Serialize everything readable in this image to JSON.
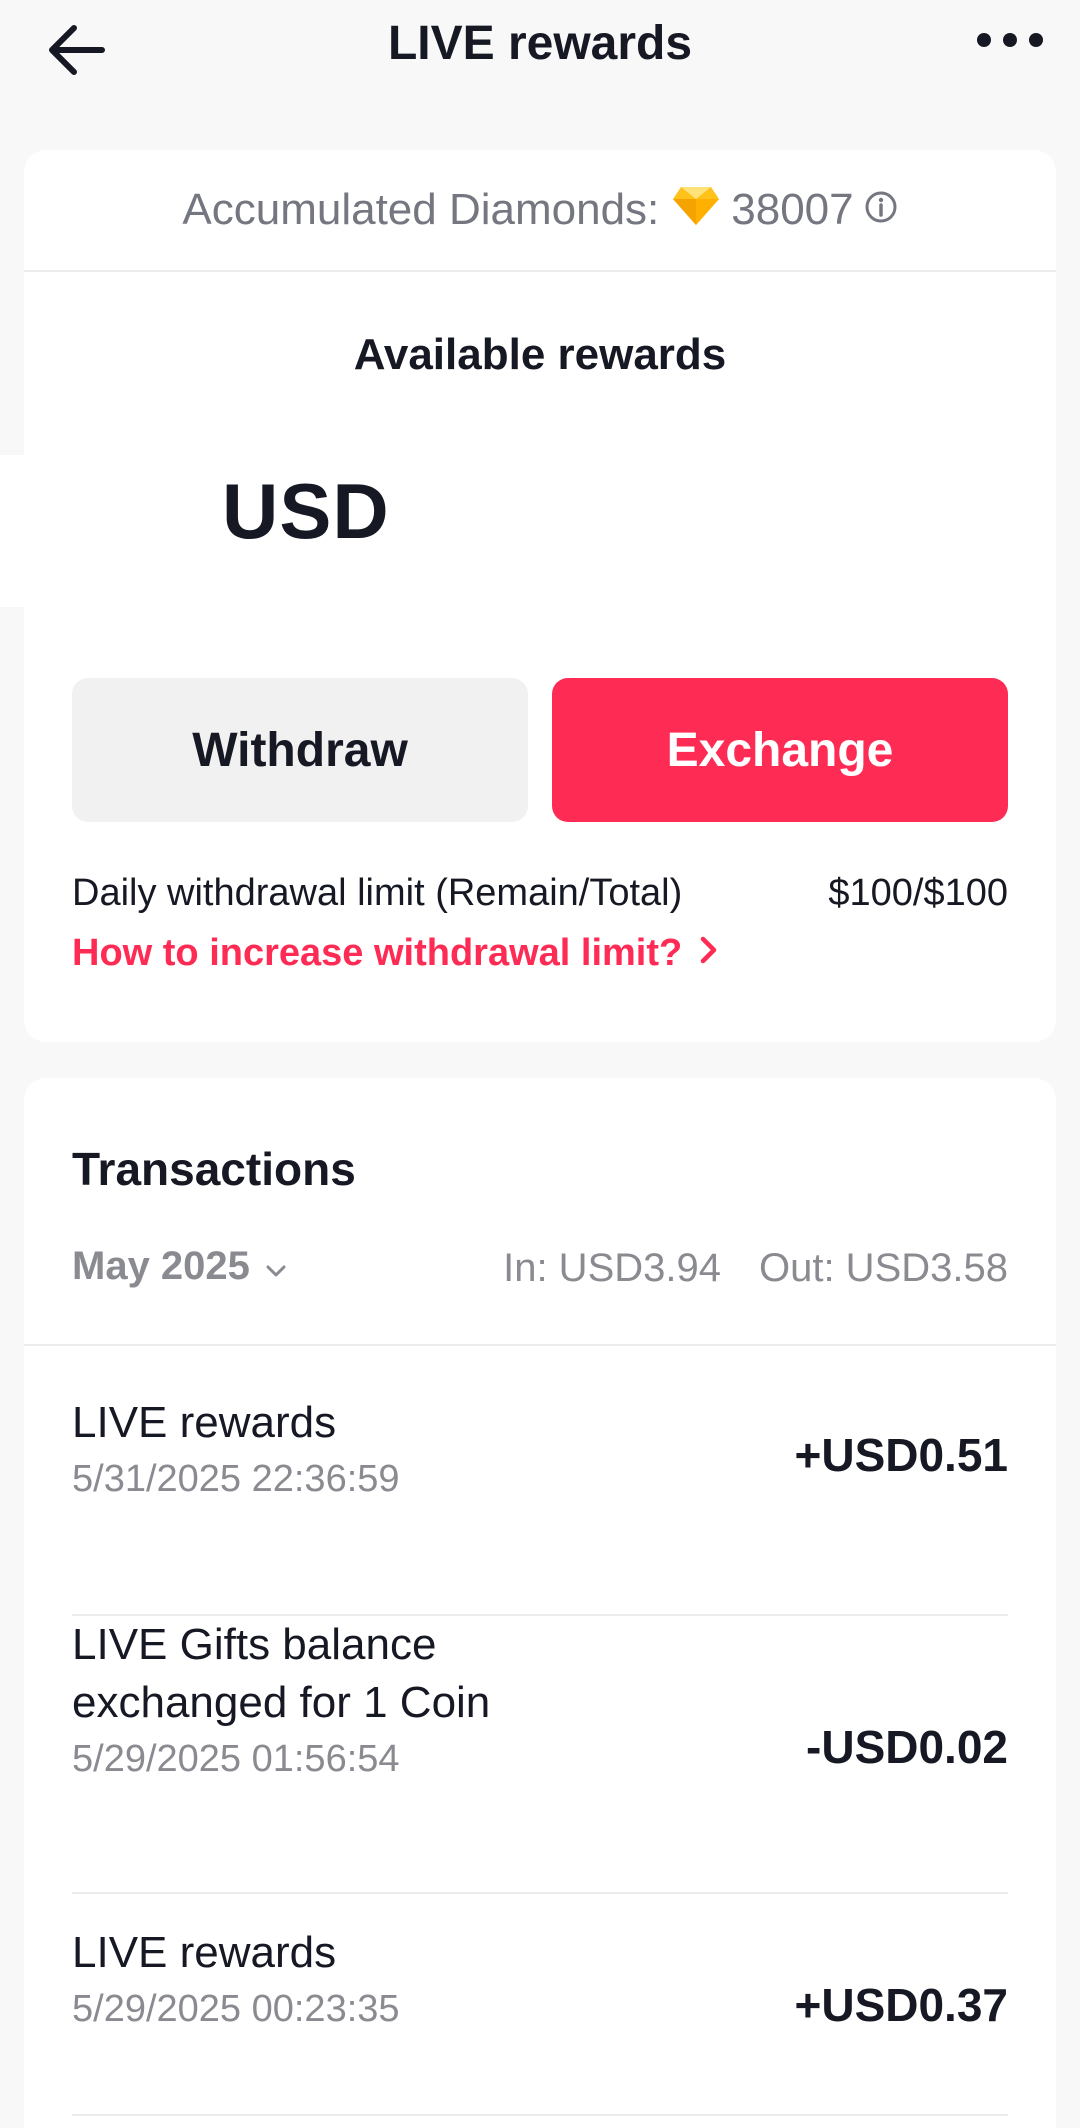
{
  "header": {
    "title": "LIVE rewards",
    "back_icon": "arrow-left-icon",
    "more_icon": "more-dots-icon"
  },
  "balance": {
    "diamonds_label": "Accumulated Diamonds:",
    "diamonds_value": "38007",
    "available_label": "Available rewards",
    "currency": "USD"
  },
  "actions": {
    "withdraw_label": "Withdraw",
    "exchange_label": "Exchange"
  },
  "limit": {
    "label": "Daily withdrawal limit (Remain/Total)",
    "value": "$100/$100",
    "link": "How to increase withdrawal limit?"
  },
  "transactions": {
    "title": "Transactions",
    "month": "May 2025",
    "in_summary": "In: USD3.94",
    "out_summary": "Out: USD3.58",
    "items": [
      {
        "name": "LIVE rewards",
        "time": "5/31/2025 22:36:59",
        "amount": "+USD0.51"
      },
      {
        "name": "LIVE Gifts balance exchanged for 1 Coin",
        "time": "5/29/2025 01:56:54",
        "amount": "-USD0.02"
      },
      {
        "name": "LIVE rewards",
        "time": "5/29/2025 00:23:35",
        "amount": "+USD0.37"
      }
    ]
  },
  "colors": {
    "accent": "#fe2c55",
    "background": "#f8f8f8",
    "muted_text": "#8a8b91"
  }
}
